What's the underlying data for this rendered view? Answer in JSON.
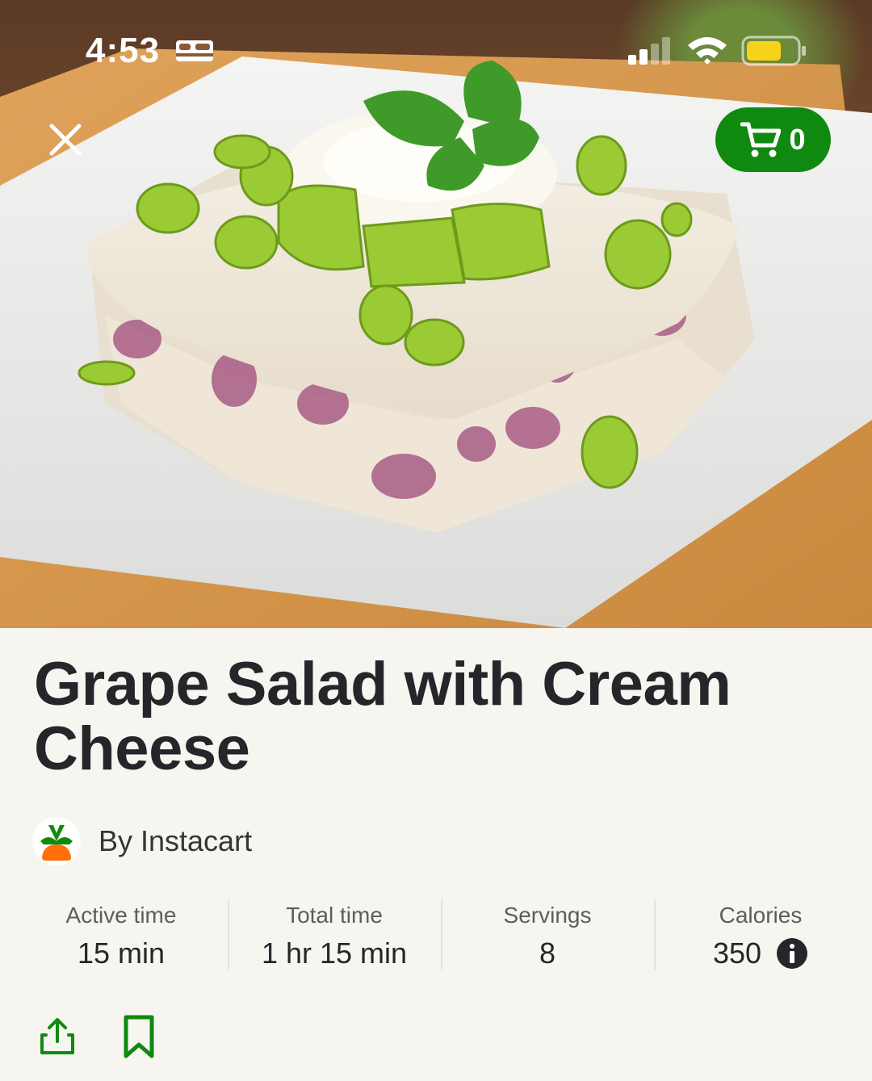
{
  "status_bar": {
    "time": "4:53",
    "icons": [
      "sleep-icon",
      "signal-icon",
      "wifi-icon",
      "battery-icon"
    ],
    "battery_color": "#f7d21a"
  },
  "header": {
    "close_icon": "close-icon",
    "cart_icon": "cart-icon",
    "cart_count": "0"
  },
  "recipe": {
    "title": "Grape Salad with Cream Cheese",
    "author": "By Instacart",
    "stats": [
      {
        "label": "Active time",
        "value": "15 min"
      },
      {
        "label": "Total time",
        "value": "1 hr 15 min"
      },
      {
        "label": "Servings",
        "value": "8"
      },
      {
        "label": "Calories",
        "value": "350"
      }
    ]
  },
  "actions": {
    "share_icon": "share-icon",
    "bookmark_icon": "bookmark-icon"
  },
  "colors": {
    "brand_green": "#108910",
    "background": "#f6f5f0",
    "text": "#25262a",
    "carrot_orange": "#ff7009"
  }
}
